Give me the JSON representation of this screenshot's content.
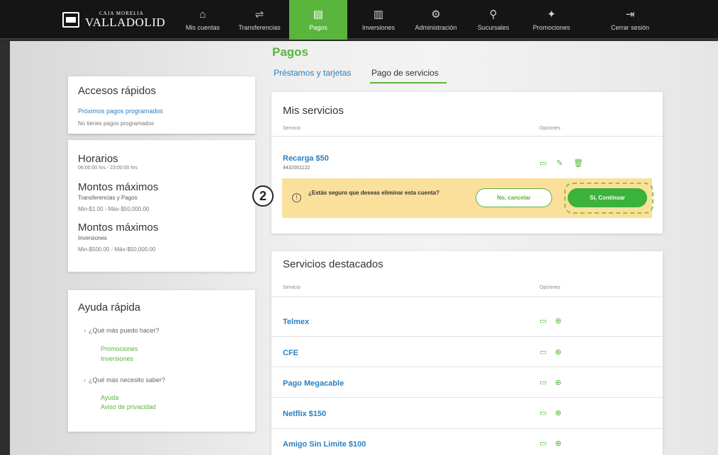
{
  "brand": {
    "small": "CAJA MORELIA",
    "big": "VALLADOLID"
  },
  "nav": [
    {
      "label": "Mis cuentas",
      "icon": "⌂",
      "active": false
    },
    {
      "label": "Transferencias",
      "icon": "⇌",
      "active": false
    },
    {
      "label": "Pagos",
      "icon": "▤",
      "active": true
    },
    {
      "label": "Inversiones",
      "icon": "▥",
      "active": false
    },
    {
      "label": "Administración",
      "icon": "⚙",
      "active": false
    },
    {
      "label": "Sucursales",
      "icon": "⚲",
      "active": false
    },
    {
      "label": "Promociones",
      "icon": "✦",
      "active": false
    },
    {
      "label": "Cerrar sesión",
      "icon": "⇥",
      "active": false
    }
  ],
  "page": {
    "title": "Pagos",
    "tabs": [
      "Préstamos y tarjetas",
      "Pago de servicios"
    ]
  },
  "accesos": {
    "title": "Accesos rápidos",
    "link": "Próximos pagos programados",
    "empty": "No tienes pagos programados"
  },
  "horarios": {
    "title": "Horarios",
    "hours": "06:00:00 hrs - 23:00:00 hrs",
    "m1_title": "Montos máximos",
    "m1_sub": "Transferencias y Pagos",
    "m1_range": "Min-$1.00 - Máx-$50,000.00",
    "m2_title": "Montos máximos",
    "m2_sub": "Inversiones",
    "m2_range": "Min-$500.00 - Máx-$50,000.00"
  },
  "ayuda": {
    "title": "Ayuda rápida",
    "q1": "¿Qué más puedo hacer?",
    "q1_links": [
      "Promociones",
      "Inversiones"
    ],
    "q2": "¿Qué más necesito saber?",
    "q2_links": [
      "Ayuda",
      "Aviso de privacidad"
    ]
  },
  "mis_servicios": {
    "title": "Mis servicios",
    "col_servicio": "Servicio",
    "col_opciones": "Opciones",
    "item_name": "Recarga $50",
    "item_number": "4432001122"
  },
  "confirm": {
    "message": "¿Estás seguro que deseas eliminar esta cuenta?",
    "cancel": "No, cancelar",
    "continue": "Sí, Continuar"
  },
  "step_number": "2",
  "destacados": {
    "title": "Servicios destacados",
    "col_servicio": "Servicio",
    "col_opciones": "Opciones",
    "items": [
      "Telmex",
      "CFE",
      "Pago Megacable",
      "Netflix $150",
      "Amigo Sin Limite $100"
    ]
  },
  "colors": {
    "green": "#5ab53c",
    "blue": "#2a7fc0",
    "warning": "#fbe09c"
  }
}
